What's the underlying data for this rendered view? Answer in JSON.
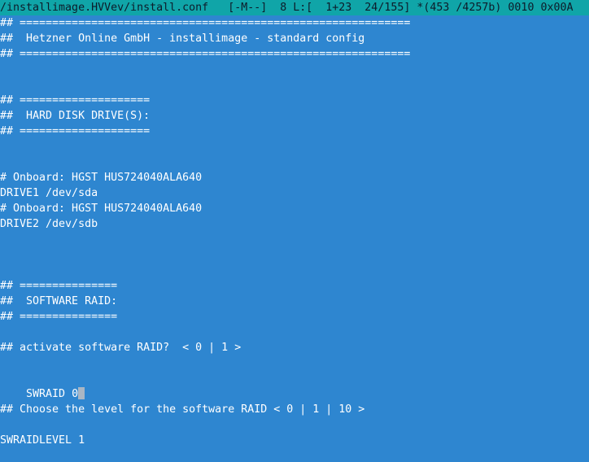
{
  "status_bar": {
    "text": "/installimage.HVVev/install.conf   [-M--]  8 L:[  1+23  24/155] *(453 /4257b) 0010 0x00A"
  },
  "editor": {
    "lines": [
      "## ============================================================",
      "##  Hetzner Online GmbH - installimage - standard config",
      "## ============================================================",
      "## ====================",
      "##  HARD DISK DRIVE(S):",
      "## ====================",
      "# Onboard: HGST HUS724040ALA640",
      "DRIVE1 /dev/sda",
      "# Onboard: HGST HUS724040ALA640",
      "DRIVE2 /dev/sdb",
      "## ===============",
      "##  SOFTWARE RAID:",
      "## ===============",
      "## activate software RAID?  < 0 | 1 >",
      "SWRAID 0",
      "## Choose the level for the software RAID < 0 | 1 | 10 >",
      "SWRAIDLEVEL 1"
    ]
  }
}
